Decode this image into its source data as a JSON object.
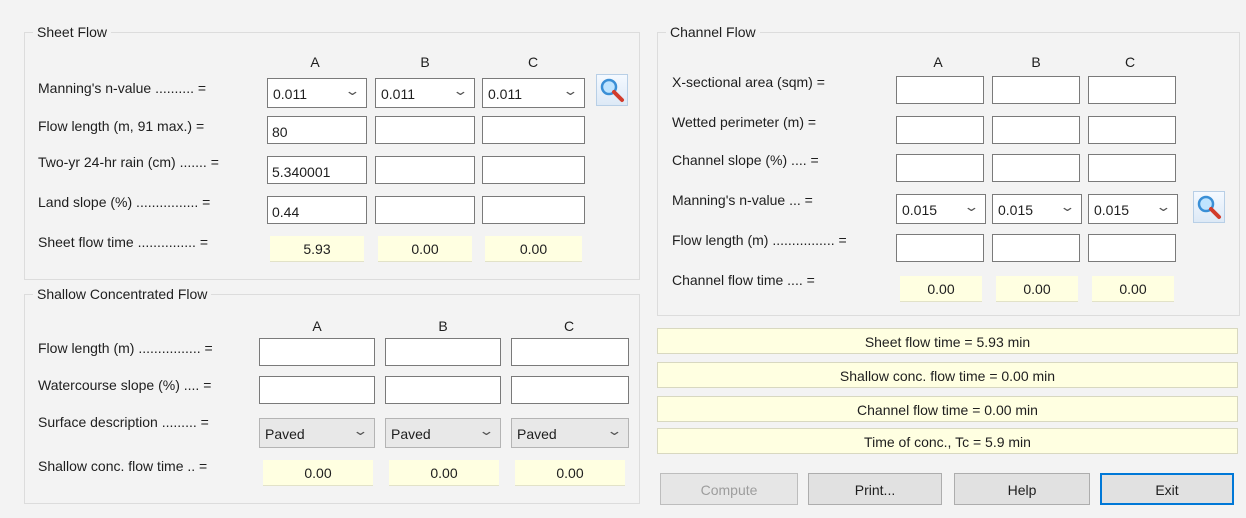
{
  "col_headers": [
    "A",
    "B",
    "C"
  ],
  "sheet": {
    "title": "Sheet Flow",
    "labels": {
      "n": "Manning's n-value .......... =",
      "length": "Flow length (m, 91 max.)  =",
      "rain": "Two-yr 24-hr rain (cm) ....... =",
      "slope": "Land slope (%) ................ =",
      "time": "Sheet flow time ............... ="
    },
    "n_values": [
      "0.011",
      "0.011",
      "0.011"
    ],
    "length": [
      "80",
      "",
      ""
    ],
    "rain": [
      "5.340001",
      "",
      ""
    ],
    "slope": [
      "0.44",
      "",
      ""
    ],
    "time": [
      "5.93",
      "0.00",
      "0.00"
    ]
  },
  "shallow": {
    "title": "Shallow Concentrated Flow",
    "labels": {
      "length": "Flow length (m)  ................ =",
      "slope": "Watercourse slope (%) .... =",
      "surface": "Surface description ......... =",
      "time": "Shallow conc. flow time .. ="
    },
    "length": [
      "",
      "",
      ""
    ],
    "slope": [
      "",
      "",
      ""
    ],
    "surface": [
      "Paved",
      "Paved",
      "Paved"
    ],
    "time": [
      "0.00",
      "0.00",
      "0.00"
    ]
  },
  "channel": {
    "title": "Channel Flow",
    "labels": {
      "area": "X-sectional area (sqm) =",
      "perimeter": "Wetted perimeter (m)  =",
      "slope": "Channel slope (%) .... =",
      "n": "Manning's n-value ... =",
      "length": "Flow length (m)  ................ =",
      "time": "Channel flow time .... ="
    },
    "area": [
      "",
      "",
      ""
    ],
    "perimeter": [
      "",
      "",
      ""
    ],
    "slope": [
      "",
      "",
      ""
    ],
    "n_values": [
      "0.015",
      "0.015",
      "0.015"
    ],
    "length": [
      "",
      "",
      ""
    ],
    "time": [
      "0.00",
      "0.00",
      "0.00"
    ]
  },
  "summary": {
    "sheet": "Sheet flow time = 5.93 min",
    "shallow": "Shallow conc. flow time = 0.00 min",
    "channel": "Channel flow time = 0.00 min",
    "tc": "Time of conc., Tc = 5.9 min"
  },
  "buttons": {
    "compute": "Compute",
    "print": "Print...",
    "help": "Help",
    "exit": "Exit"
  },
  "icons": {
    "lookup": "magnifier-icon"
  },
  "colors": {
    "output_bg": "#ffffe1",
    "default_button_border": "#0078d7"
  }
}
